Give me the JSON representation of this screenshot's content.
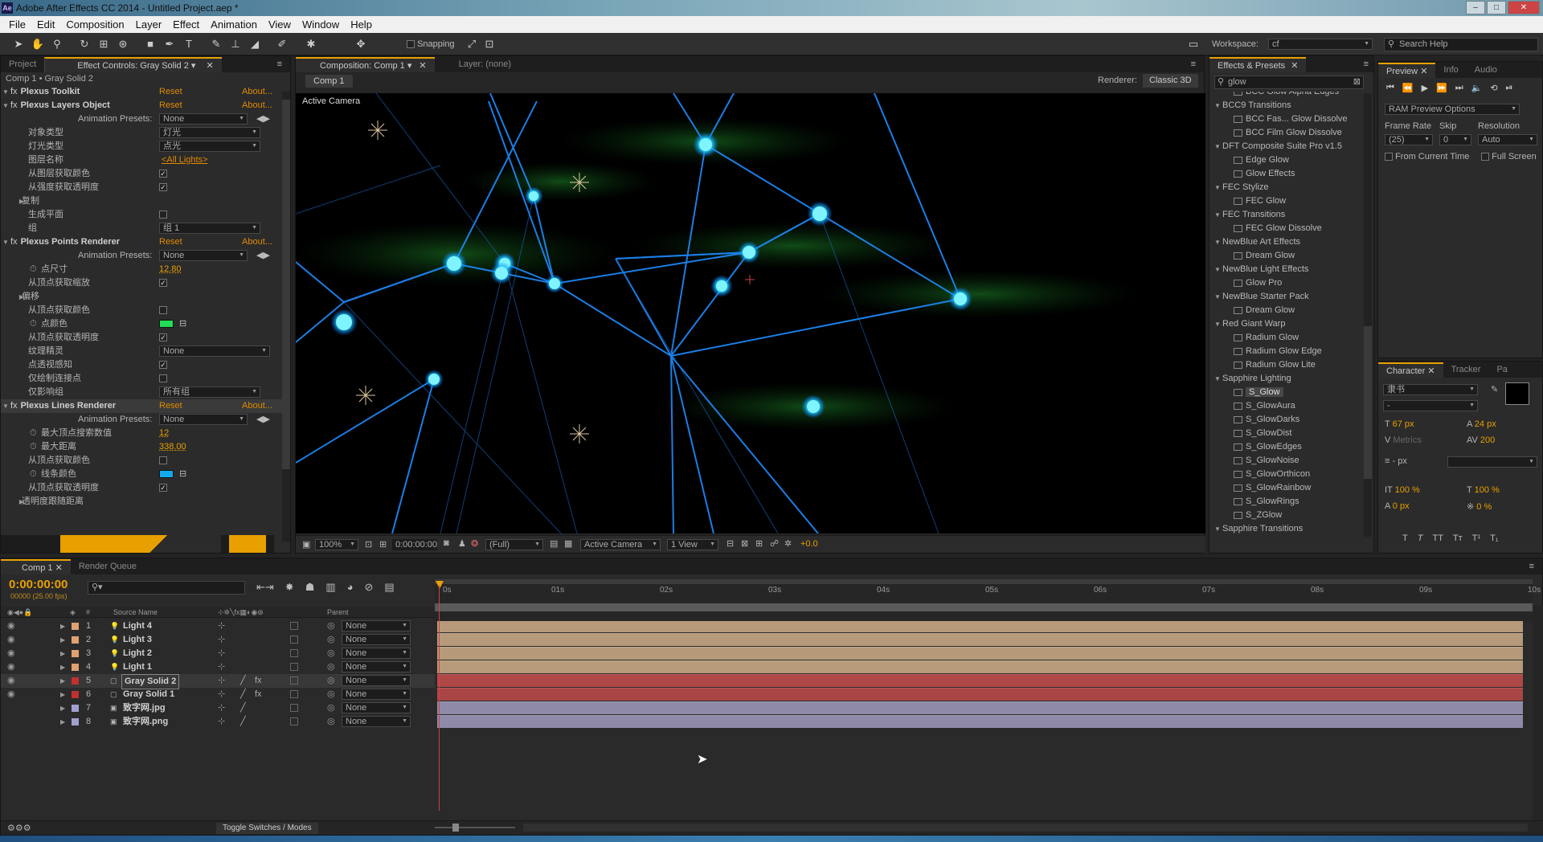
{
  "window": {
    "title": "Adobe After Effects CC 2014 - Untitled Project.aep *",
    "app_icon": "Ae"
  },
  "menu": [
    "File",
    "Edit",
    "Composition",
    "Layer",
    "Effect",
    "Animation",
    "View",
    "Window",
    "Help"
  ],
  "toolbar": {
    "snapping": "Snapping",
    "workspace_label": "Workspace:",
    "workspace_value": "cf",
    "search_placeholder": "Search Help"
  },
  "left_panel": {
    "tabs": [
      "Project",
      "Effect Controls: Gray Solid 2"
    ],
    "breadcrumb": "Comp 1 • Gray Solid 2",
    "reset": "Reset",
    "about": "About...",
    "rows": [
      {
        "type": "fx",
        "label": "Plexus Toolkit"
      },
      {
        "type": "fx",
        "label": "Plexus Layers Object"
      },
      {
        "type": "preset",
        "label": "Animation Presets:",
        "value": "None"
      },
      {
        "type": "select",
        "label": "对象类型",
        "value": "灯光"
      },
      {
        "type": "select",
        "label": "灯光类型",
        "value": "点光"
      },
      {
        "type": "link",
        "label": "图层名称",
        "value": "<All Lights>"
      },
      {
        "type": "check",
        "label": "从图层获取颜色",
        "checked": true
      },
      {
        "type": "check",
        "label": "从强度获取透明度",
        "checked": true
      },
      {
        "type": "group",
        "label": "复制"
      },
      {
        "type": "check",
        "label": "生成平面",
        "checked": false
      },
      {
        "type": "select",
        "label": "组",
        "value": "组 1"
      },
      {
        "type": "fx",
        "label": "Plexus Points Renderer"
      },
      {
        "type": "preset",
        "label": "Animation Presets:",
        "value": "None"
      },
      {
        "type": "num",
        "label": "点尺寸",
        "value": "12.80"
      },
      {
        "type": "check",
        "label": "从顶点获取缩放",
        "checked": true
      },
      {
        "type": "group",
        "label": "偏移"
      },
      {
        "type": "check",
        "label": "从顶点获取颜色",
        "checked": false
      },
      {
        "type": "color",
        "label": "点颜色",
        "color": "#22dd55"
      },
      {
        "type": "check",
        "label": "从顶点获取透明度",
        "checked": true
      },
      {
        "type": "select",
        "label": "纹理精灵",
        "value": "None"
      },
      {
        "type": "check",
        "label": "点透视感知",
        "checked": true
      },
      {
        "type": "check",
        "label": "仅绘制连接点",
        "checked": false
      },
      {
        "type": "select",
        "label": "仅影响组",
        "value": "所有组"
      },
      {
        "type": "fx",
        "label": "Plexus Lines Renderer"
      },
      {
        "type": "preset",
        "label": "Animation Presets:",
        "value": "None"
      },
      {
        "type": "num",
        "label": "最大顶点搜索数值",
        "value": "12"
      },
      {
        "type": "num",
        "label": "最大距离",
        "value": "338.00"
      },
      {
        "type": "check",
        "label": "从顶点获取颜色",
        "checked": false
      },
      {
        "type": "color",
        "label": "线条颜色",
        "color": "#11aaee"
      },
      {
        "type": "check",
        "label": "从顶点获取透明度",
        "checked": true
      },
      {
        "type": "group",
        "label": "透明度跟随距离"
      }
    ]
  },
  "comp_panel": {
    "tab": "Composition: Comp 1",
    "layer_tab": "Layer: (none)",
    "subtab": "Comp 1",
    "renderer_label": "Renderer:",
    "renderer": "Classic 3D",
    "viewer_label": "Active Camera",
    "footer": {
      "zoom": "100%",
      "time": "0:00:00:00",
      "resolution": "(Full)",
      "camera": "Active Camera",
      "view": "1 View",
      "exposure": "+0.0"
    }
  },
  "effects_presets": {
    "tab": "Effects & Presets",
    "search": "glow",
    "items": [
      {
        "kind": "fx",
        "label": "BCC Glow Alpha Edges"
      },
      {
        "kind": "cat",
        "label": "BCC9 Transitions"
      },
      {
        "kind": "fx",
        "label": "BCC Fas... Glow Dissolve"
      },
      {
        "kind": "fx",
        "label": "BCC Film Glow Dissolve"
      },
      {
        "kind": "cat",
        "label": "DFT Composite Suite Pro v1.5"
      },
      {
        "kind": "fx",
        "label": "Edge Glow"
      },
      {
        "kind": "fx",
        "label": "Glow Effects"
      },
      {
        "kind": "cat",
        "label": "FEC Stylize"
      },
      {
        "kind": "fx",
        "label": "FEC Glow"
      },
      {
        "kind": "cat",
        "label": "FEC Transitions"
      },
      {
        "kind": "fx",
        "label": "FEC Glow Dissolve"
      },
      {
        "kind": "cat",
        "label": "NewBlue Art Effects"
      },
      {
        "kind": "fx",
        "label": "Dream Glow"
      },
      {
        "kind": "cat",
        "label": "NewBlue Light Effects"
      },
      {
        "kind": "fx",
        "label": "Glow Pro"
      },
      {
        "kind": "cat",
        "label": "NewBlue Starter Pack"
      },
      {
        "kind": "fx",
        "label": "Dream Glow"
      },
      {
        "kind": "cat",
        "label": "Red Giant Warp"
      },
      {
        "kind": "fx",
        "label": "Radium Glow"
      },
      {
        "kind": "fx",
        "label": "Radium Glow Edge"
      },
      {
        "kind": "fx",
        "label": "Radium Glow Lite"
      },
      {
        "kind": "cat",
        "label": "Sapphire Lighting"
      },
      {
        "kind": "fx",
        "label": "S_Glow",
        "selected": true
      },
      {
        "kind": "fx",
        "label": "S_GlowAura"
      },
      {
        "kind": "fx",
        "label": "S_GlowDarks"
      },
      {
        "kind": "fx",
        "label": "S_GlowDist"
      },
      {
        "kind": "fx",
        "label": "S_GlowEdges"
      },
      {
        "kind": "fx",
        "label": "S_GlowNoise"
      },
      {
        "kind": "fx",
        "label": "S_GlowOrthicon"
      },
      {
        "kind": "fx",
        "label": "S_GlowRainbow"
      },
      {
        "kind": "fx",
        "label": "S_GlowRings"
      },
      {
        "kind": "fx",
        "label": "S_ZGlow"
      },
      {
        "kind": "cat",
        "label": "Sapphire Transitions"
      }
    ]
  },
  "preview": {
    "tabs": [
      "Preview",
      "Info",
      "Audio"
    ],
    "ram": "RAM Preview Options",
    "frame_rate_label": "Frame Rate",
    "skip_label": "Skip",
    "resolution_label": "Resolution",
    "frame_rate": "(25)",
    "skip": "0",
    "resolution": "Auto",
    "from_current": "From Current Time",
    "full_screen": "Full Screen"
  },
  "character": {
    "tabs": [
      "Character",
      "Tracker",
      "Pa"
    ],
    "font": "隶书",
    "style": "-",
    "size": "67 px",
    "leading": "24 px",
    "kerning": "Metrics",
    "tracking": "200",
    "stroke": "- px",
    "vscale": "100 %",
    "hscale": "100 %",
    "baseline": "0 px",
    "tsume": "0 %"
  },
  "timeline": {
    "tabs": [
      "Comp 1",
      "Render Queue"
    ],
    "timecode": "0:00:00:00",
    "fps": "00000 (25.00 fps)",
    "col_source": "Source Name",
    "col_parent": "Parent",
    "col_num": "#",
    "ruler": [
      "0s",
      "01s",
      "02s",
      "03s",
      "04s",
      "05s",
      "06s",
      "07s",
      "08s",
      "09s",
      "10s"
    ],
    "toggle": "Toggle Switches / Modes",
    "layers": [
      {
        "num": "1",
        "name": "Light 4",
        "color": "#e0a070",
        "bar": "#b79a7a",
        "icon": "light"
      },
      {
        "num": "2",
        "name": "Light 3",
        "color": "#e0a070",
        "bar": "#b79a7a",
        "icon": "light"
      },
      {
        "num": "3",
        "name": "Light 2",
        "color": "#e0a070",
        "bar": "#b79a7a",
        "icon": "light"
      },
      {
        "num": "4",
        "name": "Light 1",
        "color": "#e0a070",
        "bar": "#b79a7a",
        "icon": "light"
      },
      {
        "num": "5",
        "name": "Gray Solid 2",
        "color": "#c03030",
        "bar": "#b04848",
        "icon": "solid",
        "selected": true
      },
      {
        "num": "6",
        "name": "Gray Solid 1",
        "color": "#c03030",
        "bar": "#a94545",
        "icon": "solid"
      },
      {
        "num": "7",
        "name": "致字网.jpg",
        "color": "#a0a0d0",
        "bar": "#8f8aa8",
        "icon": "image"
      },
      {
        "num": "8",
        "name": "致字网.png",
        "color": "#a0a0d0",
        "bar": "#8f8aa8",
        "icon": "image"
      }
    ],
    "parent_value": "None"
  }
}
